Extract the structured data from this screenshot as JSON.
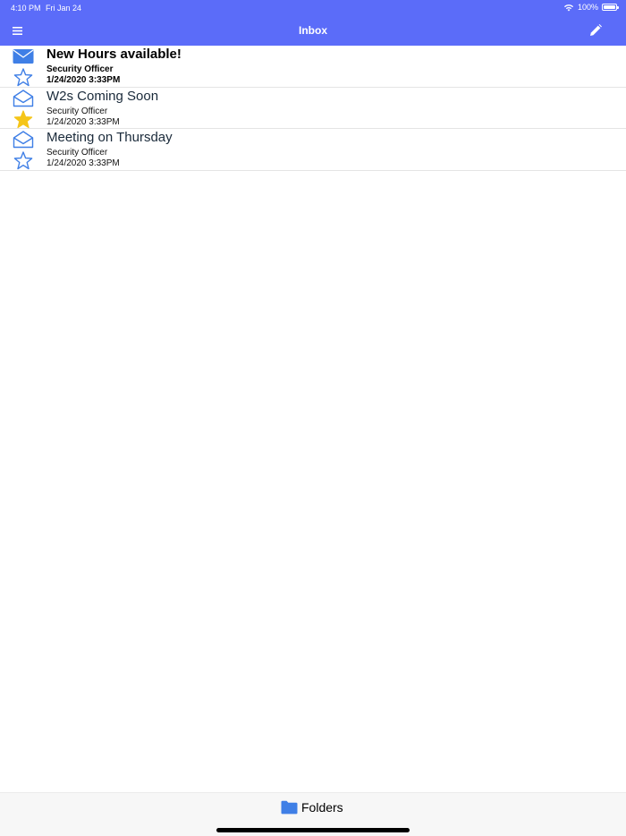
{
  "status_bar": {
    "time": "4:10 PM",
    "date": "Fri Jan 24",
    "battery": "100%",
    "icons": [
      "wifi-icon",
      "battery-icon"
    ]
  },
  "nav": {
    "title": "Inbox",
    "menu_icon": "hamburger-menu-icon",
    "compose_icon": "pencil-icon"
  },
  "colors": {
    "header_bg": "#5b6cf9",
    "icon_blue": "#3f7fe6",
    "star_yellow": "#f5c518"
  },
  "messages": [
    {
      "subject": "New Hours available!",
      "sender": "Security Officer",
      "date": "1/24/2020 3:33PM",
      "unread": true,
      "starred": false
    },
    {
      "subject": "W2s Coming Soon",
      "sender": "Security Officer",
      "date": "1/24/2020 3:33PM",
      "unread": false,
      "starred": true
    },
    {
      "subject": "Meeting on Thursday",
      "sender": "Security Officer",
      "date": "1/24/2020 3:33PM",
      "unread": false,
      "starred": false
    }
  ],
  "bottom_bar": {
    "folders_label": "Folders",
    "folders_icon": "folder-icon"
  }
}
